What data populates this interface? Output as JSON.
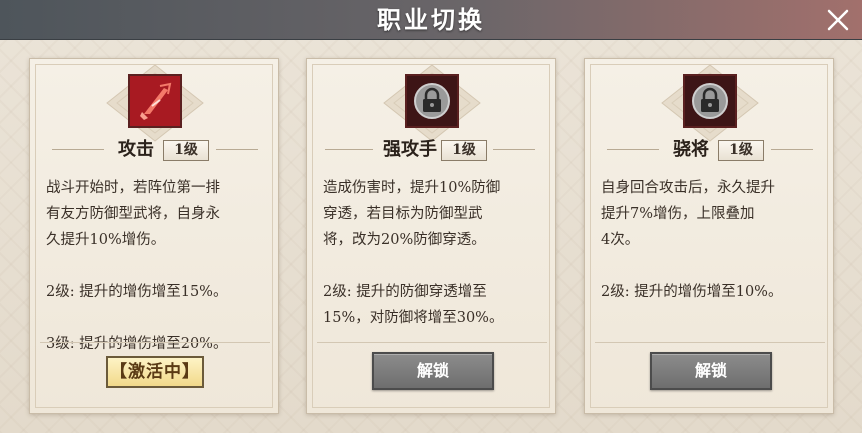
{
  "header": {
    "title": "职业切换"
  },
  "cards": [
    {
      "name": "攻击",
      "level": "1级",
      "icon": "sword-slash-icon",
      "description": "战斗开始时，若阵位第一排\n有友方防御型武将，自身永\n久提升10%增伤。\n\n2级: 提升的增伤增至15%。\n\n3级: 提升的增伤增至20%。",
      "status": "【激活中】",
      "state": "active"
    },
    {
      "name": "强攻手",
      "level": "1级",
      "icon": "lock-icon",
      "description": "造成伤害时，提升10%防御\n穿透，若目标为防御型武\n将，改为20%防御穿透。\n\n2级: 提升的防御穿透增至\n15%，对防御将增至30%。",
      "button": "解锁",
      "state": "locked"
    },
    {
      "name": "骁将",
      "level": "1级",
      "icon": "lock-icon",
      "description": "自身回合攻击后，永久提升\n提升7%增伤，上限叠加\n4次。\n\n2级: 提升的增伤增至10%。",
      "button": "解锁",
      "state": "locked"
    }
  ],
  "colors": {
    "header_left": "#4e555b",
    "header_right": "#a2706c",
    "active_icon_bg": "#a81a22",
    "locked_icon_bg": "#3d1516",
    "button_gray": "#7a7a7a",
    "status_gold": "#f2d98a"
  }
}
